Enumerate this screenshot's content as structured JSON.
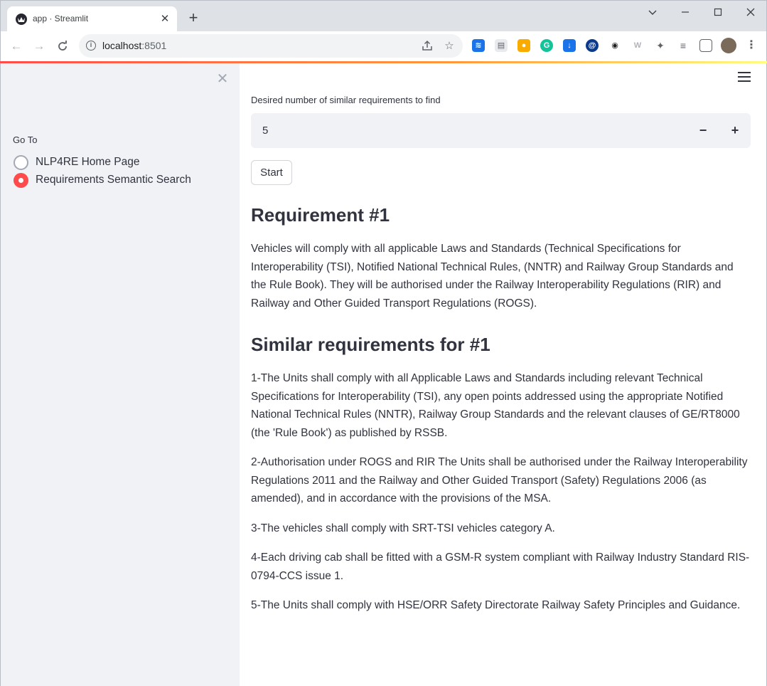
{
  "browser": {
    "tab_title": "app · Streamlit",
    "tab_close": "✕",
    "new_tab": "+",
    "url_host": "localhost",
    "url_port": ":8501",
    "icons": [
      "back-icon",
      "forward-icon",
      "reload-icon",
      "info-icon",
      "share-icon",
      "star-icon",
      "extensions-icon",
      "profile-icon",
      "menu-icon"
    ]
  },
  "sidebar": {
    "close": "✕",
    "radio_label": "Go To",
    "options": [
      {
        "label": "NLP4RE Home Page",
        "selected": false
      },
      {
        "label": "Requirements Semantic Search",
        "selected": true
      }
    ]
  },
  "main": {
    "number_input": {
      "label": "Desired number of similar requirements to find",
      "value": "5",
      "minus": "−",
      "plus": "+"
    },
    "start_button": "Start",
    "requirement_heading": "Requirement #1",
    "requirement_text": "Vehicles will comply with all applicable Laws and Standards (Technical Specifications for Interoperability (TSI), Notified National Technical Rules, (NNTR) and Railway Group Standards and the Rule Book). They will be authorised under the Railway Interoperability Regulations (RIR) and Railway and Other Guided Transport Regulations (ROGS).",
    "similar_heading": "Similar requirements for #1",
    "similar": [
      "1-The Units shall comply with all Applicable Laws and Standards including relevant Technical Specifications for Interoperability (TSI), any open points addressed using the appropriate Notified National Technical Rules (NNTR), Railway Group Standards and the relevant clauses of GE/RT8000 (the 'Rule Book') as published by RSSB.",
      "2-Authorisation under ROGS and RIR The Units shall be authorised under the Railway Interoperability Regulations 2011 and the Railway and Other Guided Transport (Safety) Regulations 2006 (as amended), and in accordance with the provisions of the MSA.",
      "3-The vehicles shall comply with SRT-TSI vehicles category A.",
      "4-Each driving cab shall be fitted with a GSM-R system compliant with Railway Industry Standard RIS-0794-CCS issue 1.",
      "5-The Units shall comply with HSE/ORR Safety Directorate Railway Safety Principles and Guidance."
    ]
  },
  "colors": {
    "accent": "#ff4b4b",
    "sidebar_bg": "#f0f2f6",
    "text": "#31333f"
  }
}
